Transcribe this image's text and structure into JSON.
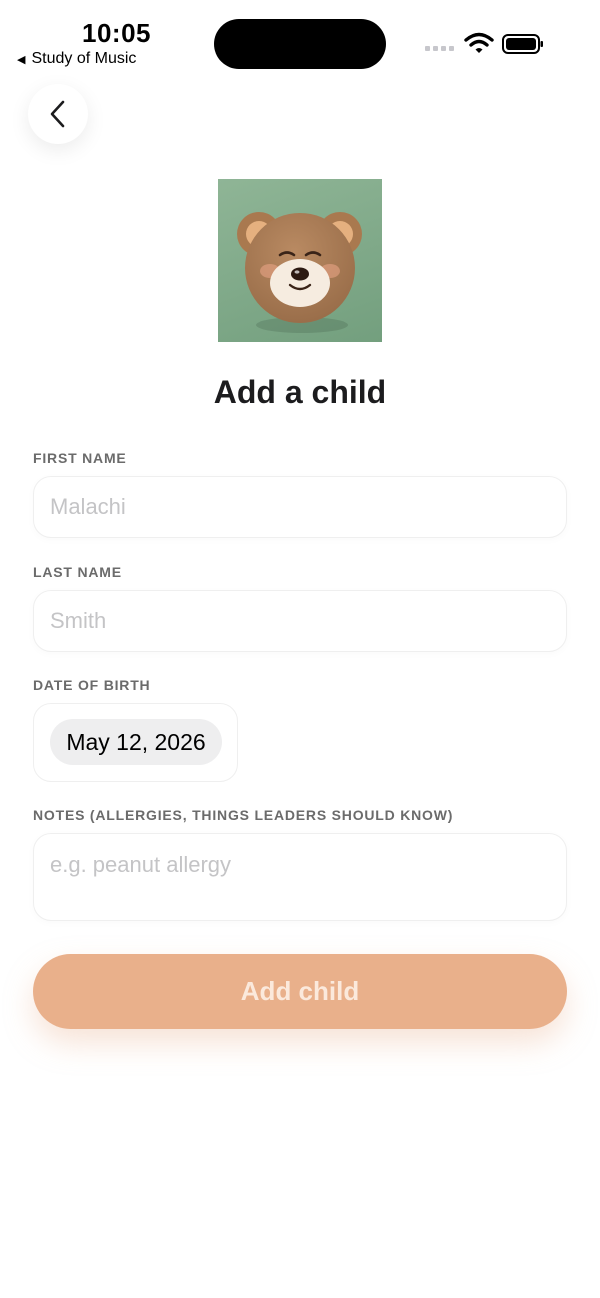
{
  "status_bar": {
    "time": "10:05",
    "back_app": "Study of Music",
    "back_icon": "back-triangle-icon"
  },
  "header": {
    "back_icon": "chevron-left-icon"
  },
  "avatar": {
    "icon": "bear-face-icon"
  },
  "title": "Add a child",
  "form": {
    "first_name": {
      "label": "FIRST NAME",
      "placeholder": "Malachi",
      "value": ""
    },
    "last_name": {
      "label": "LAST NAME",
      "placeholder": "Smith",
      "value": ""
    },
    "date_of_birth": {
      "label": "DATE OF BIRTH",
      "value": "May 12, 2026"
    },
    "notes": {
      "label": "NOTES (ALLERGIES, THINGS LEADERS SHOULD KNOW)",
      "placeholder": "e.g. peanut allergy",
      "value": ""
    }
  },
  "submit": {
    "label": "Add child"
  },
  "colors": {
    "accent": "#e9b08b",
    "avatar_bg": "#80aa8a"
  }
}
